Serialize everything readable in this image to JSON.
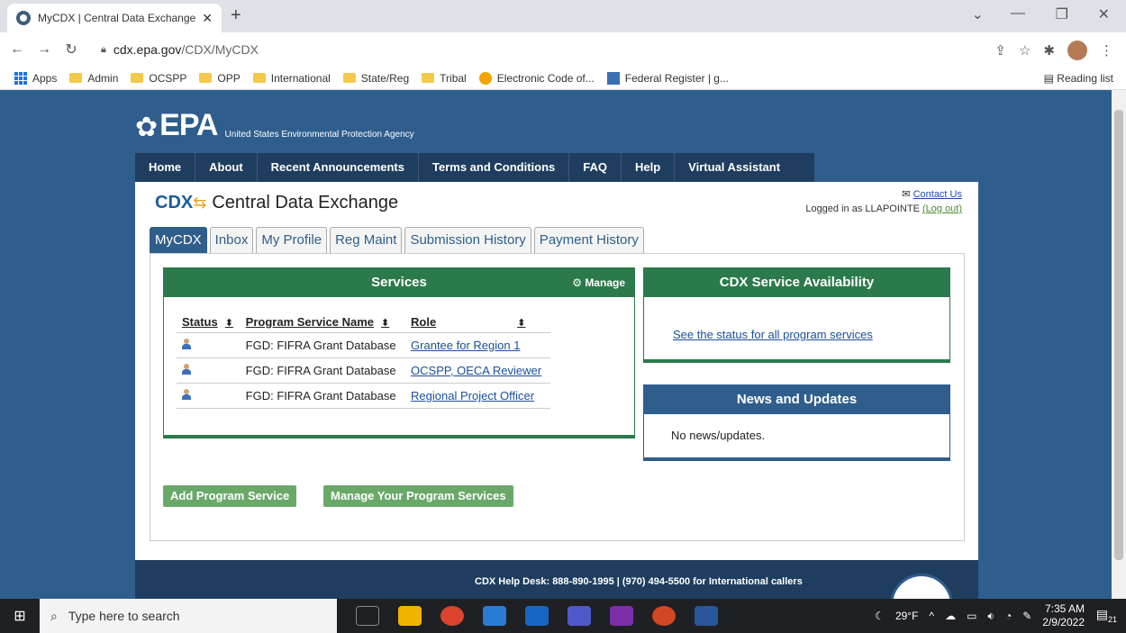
{
  "browser": {
    "tab_title": "MyCDX | Central Data Exchange |",
    "url_host": "cdx.epa.gov",
    "url_path": "/CDX/MyCDX",
    "bookmarks": [
      "Apps",
      "Admin",
      "OCSPP",
      "OPP",
      "International",
      "State/Reg",
      "Tribal",
      "Electronic Code of...",
      "Federal Register | g..."
    ],
    "reading_list": "Reading list"
  },
  "header": {
    "logo_text": "EPA",
    "agency": "United States Environmental Protection Agency",
    "nav": [
      "Home",
      "About",
      "Recent Announcements",
      "Terms and Conditions",
      "FAQ",
      "Help",
      "Virtual Assistant"
    ]
  },
  "cdx": {
    "mark": "CDX",
    "title": "Central Data Exchange",
    "contact_us": "Contact Us",
    "logged_in_prefix": "Logged in as LLAPOINTE",
    "logout": "(Log out)",
    "tabs": [
      "MyCDX",
      "Inbox",
      "My Profile",
      "Reg Maint",
      "Submission History",
      "Payment History"
    ]
  },
  "services": {
    "title": "Services",
    "manage": "Manage",
    "columns": [
      "Status",
      "Program Service Name",
      "Role"
    ],
    "rows": [
      {
        "name": "FGD: FIFRA Grant Database",
        "role": "Grantee for Region 1"
      },
      {
        "name": "FGD: FIFRA Grant Database",
        "role": "OCSPP, OECA Reviewer"
      },
      {
        "name": "FGD: FIFRA Grant Database",
        "role": "Regional Project Officer"
      }
    ],
    "add_button": "Add Program Service",
    "manage_button": "Manage Your Program Services"
  },
  "availability": {
    "title": "CDX Service Availability",
    "link": "See the status for all program services"
  },
  "news": {
    "title": "News and Updates",
    "body": "No news/updates."
  },
  "footer": {
    "help": "CDX Help Desk: 888-890-1995 | (970) 494-5500 for International callers"
  },
  "taskbar": {
    "search_placeholder": "Type here to search",
    "weather": "29°F",
    "time": "7:35 AM",
    "date": "2/9/2022",
    "notifications": "21"
  },
  "colors": {
    "epa_blue": "#2f5e8c",
    "nav_dark": "#1f3e5f",
    "services_green": "#2b7a4b",
    "button_green": "#6aa86a"
  }
}
